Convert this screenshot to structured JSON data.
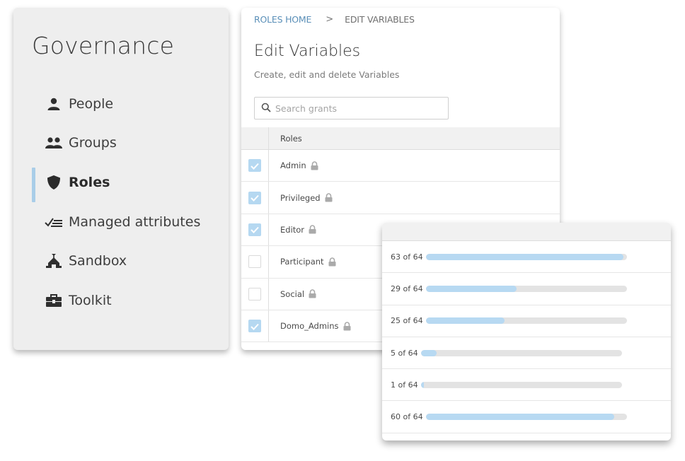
{
  "sidebar": {
    "title": "Governance",
    "items": [
      {
        "label": "People",
        "icon": "person-icon",
        "active": false
      },
      {
        "label": "Groups",
        "icon": "groups-icon",
        "active": false
      },
      {
        "label": "Roles",
        "icon": "shield-icon",
        "active": true
      },
      {
        "label": "Managed attributes",
        "icon": "checklist-icon",
        "active": false
      },
      {
        "label": "Sandbox",
        "icon": "sandbox-icon",
        "active": false
      },
      {
        "label": "Toolkit",
        "icon": "toolbox-icon",
        "active": false
      }
    ]
  },
  "main": {
    "breadcrumb": {
      "home": "ROLES HOME",
      "separator": ">",
      "current": "EDIT VARIABLES"
    },
    "title": "Edit Variables",
    "subtitle": "Create, edit and delete Variables",
    "search_placeholder": "Search grants",
    "table": {
      "header": "Roles",
      "rows": [
        {
          "label": "Admin",
          "checked": true
        },
        {
          "label": "Privileged",
          "checked": true
        },
        {
          "label": "Editor",
          "checked": true
        },
        {
          "label": "Participant",
          "checked": false
        },
        {
          "label": "Social",
          "checked": false
        },
        {
          "label": "Domo_Admins",
          "checked": true
        }
      ]
    }
  },
  "progress": {
    "rows": [
      {
        "label": "63 of 64",
        "value": 63,
        "total": 64
      },
      {
        "label": "29 of 64",
        "value": 29,
        "total": 64
      },
      {
        "label": "25 of 64",
        "value": 25,
        "total": 64
      },
      {
        "label": "5 of 64",
        "value": 5,
        "total": 64
      },
      {
        "label": "1 of 64",
        "value": 1,
        "total": 64
      },
      {
        "label": "60 of 64",
        "value": 60,
        "total": 64
      }
    ]
  },
  "colors": {
    "accent": "#a9cde8",
    "checkbox_checked": "#b5d8f1",
    "progress_fill": "#b7d9f2",
    "progress_track": "#e3e3e3",
    "link": "#5a8fb8"
  }
}
